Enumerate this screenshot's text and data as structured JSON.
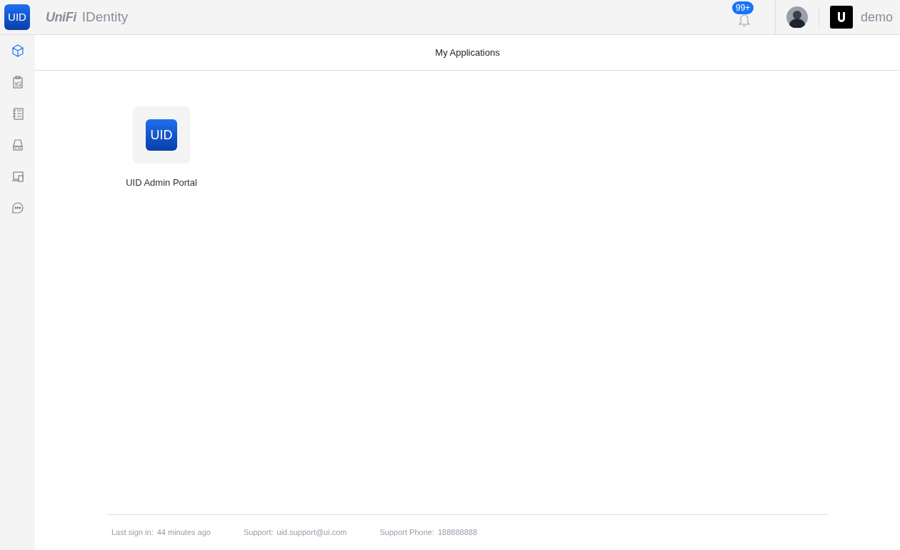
{
  "header": {
    "logo_text": "UID",
    "brand": "UniFi",
    "product": "IDentity",
    "notifications_badge": "99+",
    "username": "demo"
  },
  "sidebar": {
    "items": [
      {
        "kind": "cube",
        "selected": true
      },
      {
        "kind": "clipboard",
        "selected": false
      },
      {
        "kind": "list",
        "selected": false
      },
      {
        "kind": "drive",
        "selected": false
      },
      {
        "kind": "devices",
        "selected": false
      },
      {
        "kind": "chat",
        "selected": false
      }
    ]
  },
  "page_title": "My Applications",
  "applications": [
    {
      "icon_text": "UID",
      "name": "UID Admin Portal"
    }
  ],
  "footer": [
    {
      "label": "Last sign in:",
      "value": "44 minutes ago"
    },
    {
      "label": "Support:",
      "value": "uid.support@ui.com"
    },
    {
      "label": "Support Phone:",
      "value": "188888888"
    }
  ]
}
